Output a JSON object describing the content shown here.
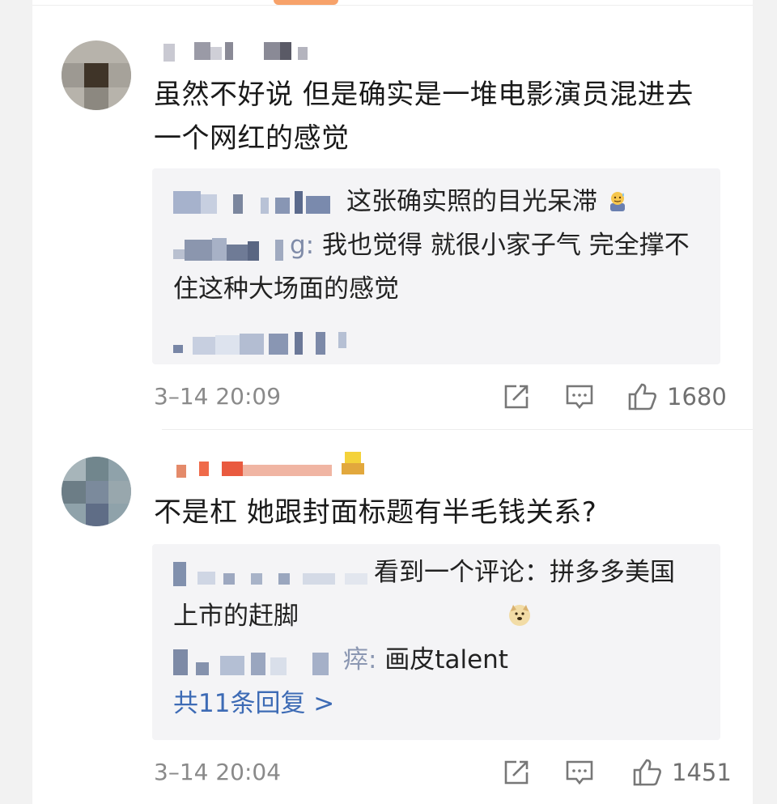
{
  "comments": [
    {
      "text": "虽然不好说 但是确实是一堆电影演员混进去一个网红的感觉",
      "replies": [
        {
          "name_suffix": "",
          "text": "这张确实照的目光呆滞",
          "emoji": "sweat-emoji"
        },
        {
          "name_suffix": "g:",
          "text": "我也觉得 就很小家子气 完全撑不住这种大场面的感觉"
        }
      ],
      "time": "3–14 20:09",
      "likes": "1680"
    },
    {
      "text": "不是杠 她跟封面标题有半毛钱关系?",
      "replies": [
        {
          "name_suffix": "",
          "text": "看到一个评论：拼多多美国上市的赶脚",
          "emoji": "doge-emoji"
        },
        {
          "name_suffix": "瘁:",
          "text": "画皮talent"
        }
      ],
      "more_replies": "共11条回复 >",
      "time": "3–14 20:04",
      "likes": "1451"
    }
  ],
  "colors": {
    "link": "#3d6bb5",
    "reply_bg": "#f4f4f6",
    "meta": "#8a8a8a"
  },
  "icons": [
    "share-icon",
    "comment-icon",
    "like-icon"
  ]
}
